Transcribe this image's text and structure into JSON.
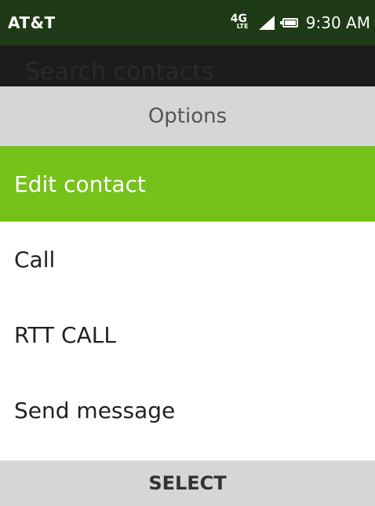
{
  "status_bar": {
    "carrier": "AT&T",
    "network_badge": "4G",
    "network_sub": "LTE",
    "time": "9:30 AM",
    "icons": [
      "network-4g-lte-icon",
      "signal-icon",
      "battery-icon"
    ]
  },
  "search": {
    "placeholder": "Search contacts"
  },
  "options": {
    "title": "Options",
    "items": [
      {
        "label": "Edit contact",
        "selected": true
      },
      {
        "label": "Call",
        "selected": false
      },
      {
        "label": "RTT CALL",
        "selected": false
      },
      {
        "label": "Send message",
        "selected": false
      }
    ]
  },
  "softkey": {
    "center": "SELECT"
  },
  "colors": {
    "status_bar_bg": "#1f3a16",
    "highlight": "#76c21b",
    "header_bg": "#d6d6d6"
  }
}
